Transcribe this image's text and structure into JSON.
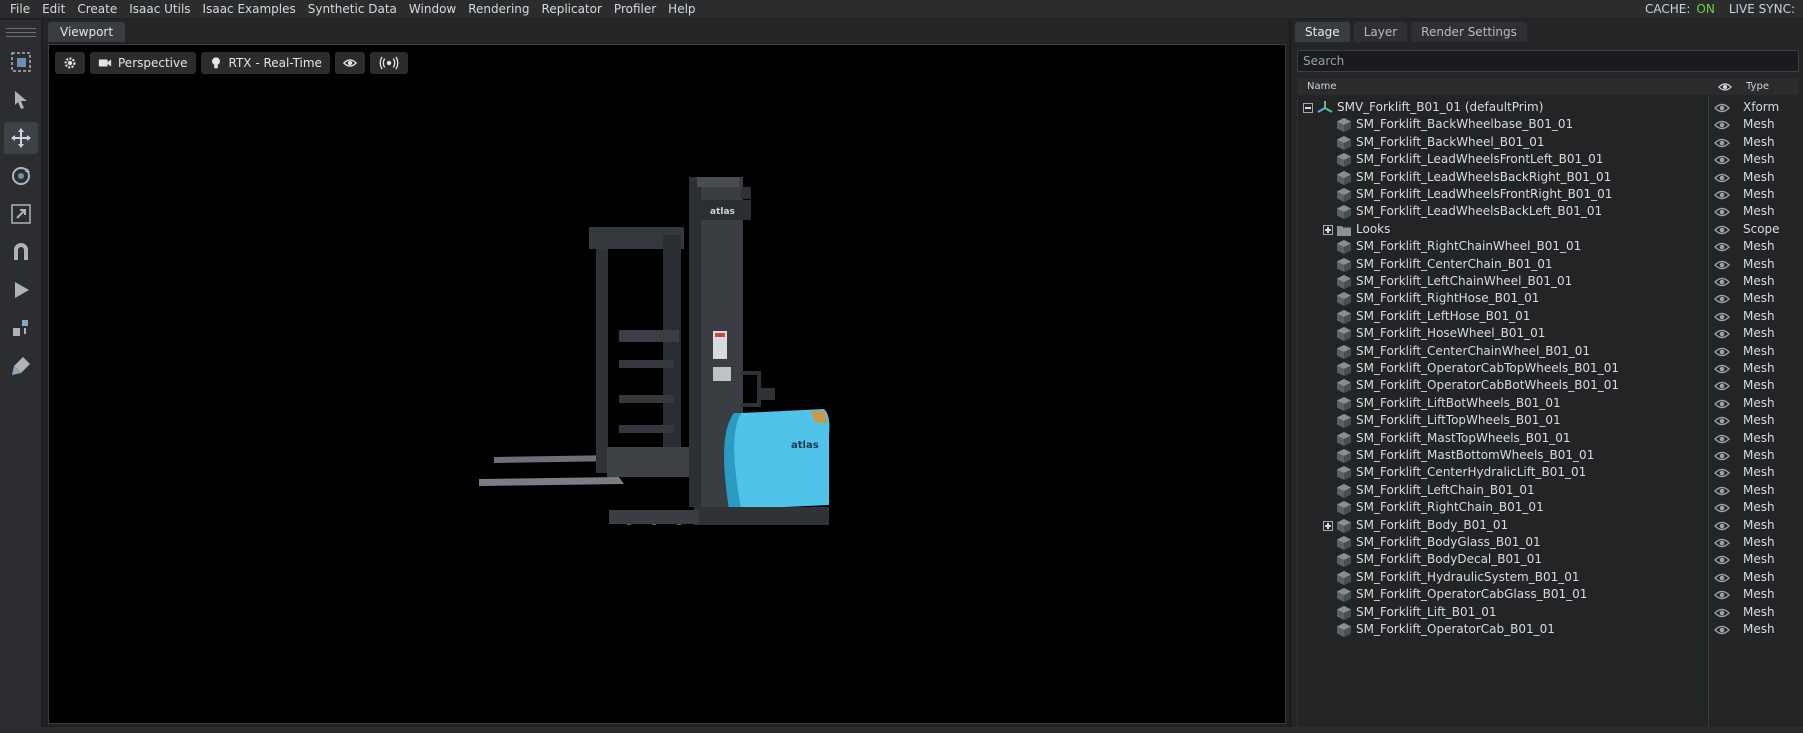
{
  "menubar": {
    "items": [
      "File",
      "Edit",
      "Create",
      "Isaac Utils",
      "Isaac Examples",
      "Synthetic Data",
      "Window",
      "Rendering",
      "Replicator",
      "Profiler",
      "Help"
    ],
    "cache_label": "CACHE:",
    "cache_value": "ON",
    "live_sync_label": "LIVE SYNC:"
  },
  "toolbar": {
    "tools": [
      "select-mode-icon",
      "select-icon",
      "move-icon",
      "rotate-icon",
      "scale-icon",
      "snap-icon",
      "play-icon",
      "physics-icon",
      "paint-icon"
    ],
    "active_tool": "move-icon"
  },
  "viewport": {
    "tab": "Viewport",
    "camera_label": "Perspective",
    "render_label": "RTX - Real-Time",
    "forklift_brand": "atlas",
    "colors": {
      "forklift_body": "#4fc3ea",
      "mast": "#3a3d42"
    }
  },
  "stage": {
    "tabs": [
      "Stage",
      "Layer",
      "Render Settings"
    ],
    "search_placeholder": "Search",
    "columns": {
      "name": "Name",
      "type": "Type"
    },
    "root": {
      "label": "SMV_Forklift_B01_01 (defaultPrim)",
      "type": "Xform"
    },
    "rows": [
      {
        "label": "SM_Forklift_BackWheelbase_B01_01",
        "type": "Mesh"
      },
      {
        "label": "SM_Forklift_BackWheel_B01_01",
        "type": "Mesh"
      },
      {
        "label": "SM_Forklift_LeadWheelsFrontLeft_B01_01",
        "type": "Mesh"
      },
      {
        "label": "SM_Forklift_LeadWheelsBackRight_B01_01",
        "type": "Mesh"
      },
      {
        "label": "SM_Forklift_LeadWheelsFrontRight_B01_01",
        "type": "Mesh"
      },
      {
        "label": "SM_Forklift_LeadWheelsBackLeft_B01_01",
        "type": "Mesh"
      },
      {
        "label": "Looks",
        "type": "Scope",
        "folder": true
      },
      {
        "label": "SM_Forklift_RightChainWheel_B01_01",
        "type": "Mesh"
      },
      {
        "label": "SM_Forklift_CenterChain_B01_01",
        "type": "Mesh"
      },
      {
        "label": "SM_Forklift_LeftChainWheel_B01_01",
        "type": "Mesh"
      },
      {
        "label": "SM_Forklift_RightHose_B01_01",
        "type": "Mesh"
      },
      {
        "label": "SM_Forklift_LeftHose_B01_01",
        "type": "Mesh"
      },
      {
        "label": "SM_Forklift_HoseWheel_B01_01",
        "type": "Mesh"
      },
      {
        "label": "SM_Forklift_CenterChainWheel_B01_01",
        "type": "Mesh"
      },
      {
        "label": "SM_Forklift_OperatorCabTopWheels_B01_01",
        "type": "Mesh"
      },
      {
        "label": "SM_Forklift_OperatorCabBotWheels_B01_01",
        "type": "Mesh"
      },
      {
        "label": "SM_Forklift_LiftBotWheels_B01_01",
        "type": "Mesh"
      },
      {
        "label": "SM_Forklift_LiftTopWheels_B01_01",
        "type": "Mesh"
      },
      {
        "label": "SM_Forklift_MastTopWheels_B01_01",
        "type": "Mesh"
      },
      {
        "label": "SM_Forklift_MastBottomWheels_B01_01",
        "type": "Mesh"
      },
      {
        "label": "SM_Forklift_CenterHydralicLift_B01_01",
        "type": "Mesh"
      },
      {
        "label": "SM_Forklift_LeftChain_B01_01",
        "type": "Mesh"
      },
      {
        "label": "SM_Forklift_RightChain_B01_01",
        "type": "Mesh"
      },
      {
        "label": "SM_Forklift_Body_B01_01",
        "type": "Mesh",
        "expandable": true
      },
      {
        "label": "SM_Forklift_BodyGlass_B01_01",
        "type": "Mesh"
      },
      {
        "label": "SM_Forklift_BodyDecal_B01_01",
        "type": "Mesh"
      },
      {
        "label": "SM_Forklift_HydraulicSystem_B01_01",
        "type": "Mesh"
      },
      {
        "label": "SM_Forklift_OperatorCabGlass_B01_01",
        "type": "Mesh"
      },
      {
        "label": "SM_Forklift_Lift_B01_01",
        "type": "Mesh"
      },
      {
        "label": "SM_Forklift_OperatorCab_B01_01",
        "type": "Mesh"
      }
    ]
  }
}
